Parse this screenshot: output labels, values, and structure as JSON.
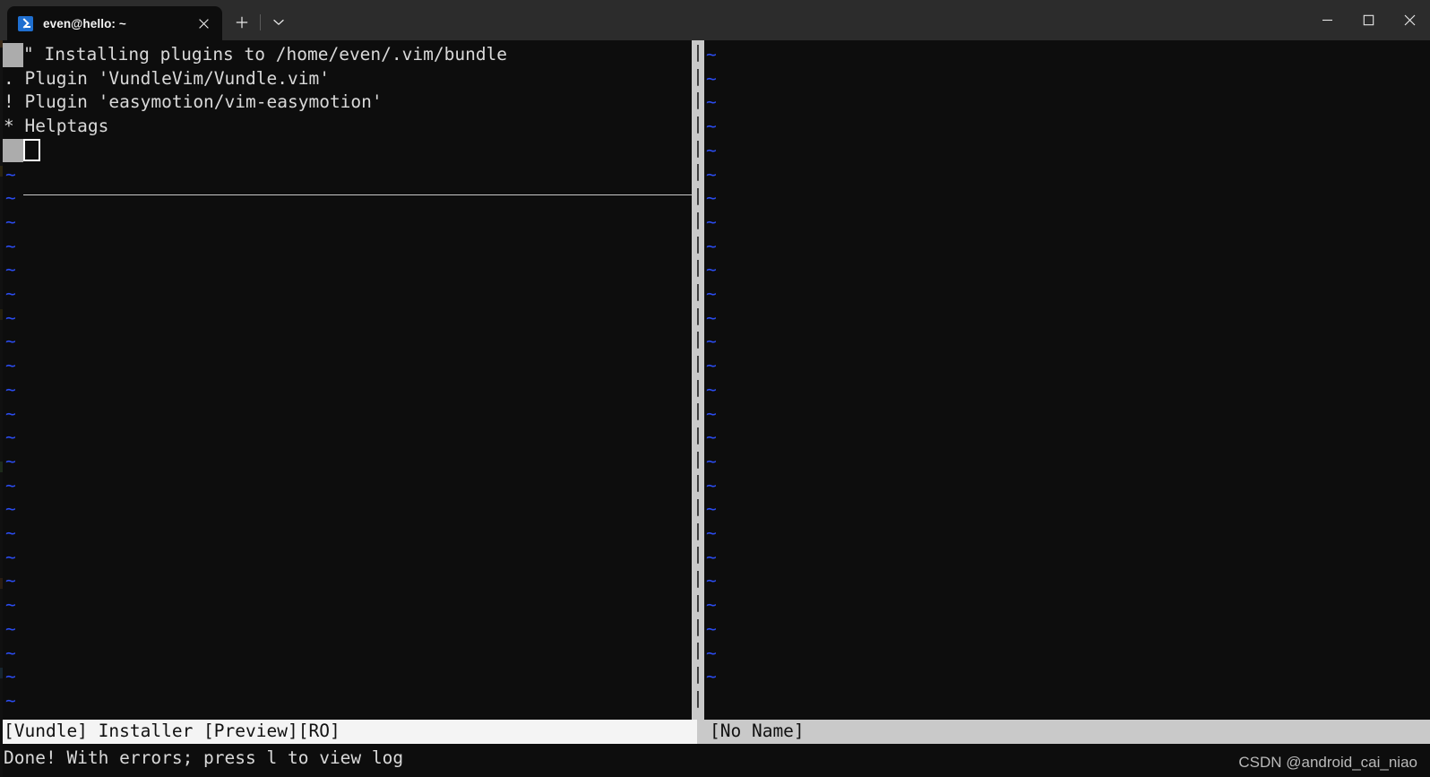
{
  "window": {
    "app": "Windows Terminal",
    "background_color": "#0d0d0d",
    "titlebar_color": "#2c2c2c",
    "controls": {
      "minimize_label": "Minimize",
      "maximize_label": "Maximize",
      "close_label": "Close"
    }
  },
  "tabbar": {
    "tabs": [
      {
        "title": "even@hello: ~",
        "icon": "powershell-prompt-icon",
        "icon_color": "#1f6fd0",
        "active": true,
        "close_label": "Close tab"
      }
    ],
    "new_tab_label": "+",
    "new_tab_icon": "plus-icon",
    "dropdown_icon": "chevron-down-icon"
  },
  "editor": {
    "app": "vim",
    "fold_column_color": "#acacac",
    "tilde_color": "#2b4cf0",
    "left_pane": {
      "name": "vundle-installer-pane",
      "lines": [
        {
          "sign": true,
          "text": "\" Installing plugins to /home/even/.vim/bundle"
        },
        {
          "sign": false,
          "text": ". Plugin 'VundleVim/Vundle.vim'"
        },
        {
          "sign": false,
          "text": "! Plugin 'easymotion/vim-easymotion'"
        },
        {
          "sign": false,
          "text": "* Helptags"
        }
      ],
      "cursor_row_index": 4,
      "filler_char": "~",
      "filler_count": 23,
      "statusline": "[Vundle] Installer [Preview][RO]",
      "statusline_bg": "#f4f4f4",
      "statusline_fg": "#111111"
    },
    "right_pane": {
      "name": "no-name-pane",
      "filler_char": "~",
      "filler_count": 27,
      "statusline": "[No Name]",
      "statusline_bg": "#c9c9c9",
      "statusline_fg": "#111111"
    },
    "split_separator": {
      "char": "|",
      "bg": "#c9c9c9",
      "fg": "#1b1b1b",
      "count": 28
    },
    "message": "Done! With errors; press l to view log"
  },
  "watermark": {
    "text": "CSDN @android_cai_niao"
  }
}
